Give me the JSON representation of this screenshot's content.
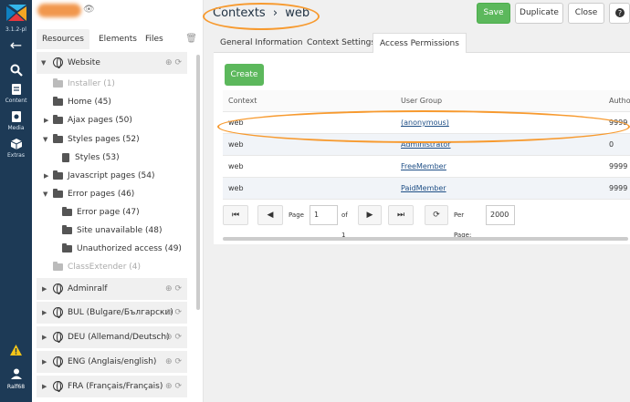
{
  "rail": {
    "version": "3.1.2-pl",
    "nav": [
      {
        "icon": "search-icon",
        "label": ""
      },
      {
        "icon": "content-icon",
        "label": "Content"
      },
      {
        "icon": "media-icon",
        "label": "Media"
      },
      {
        "icon": "extras-icon",
        "label": "Extras"
      }
    ],
    "user": "Ralf68"
  },
  "tree": {
    "tabs": [
      "Resources",
      "Elements",
      "Files"
    ],
    "nodes": [
      {
        "label": "Website",
        "type": "context"
      },
      {
        "label": "Installer (1)",
        "type": "folder",
        "dim": true
      },
      {
        "label": "Home (45)",
        "type": "folder"
      },
      {
        "label": "Ajax pages (50)",
        "type": "folder"
      },
      {
        "label": "Styles pages (52)",
        "type": "folder"
      },
      {
        "label": "Styles (53)",
        "type": "page"
      },
      {
        "label": "Javascript pages (54)",
        "type": "folder"
      },
      {
        "label": "Error pages (46)",
        "type": "folder"
      },
      {
        "label": "Error page (47)",
        "type": "folder"
      },
      {
        "label": "Site unavailable (48)",
        "type": "folder"
      },
      {
        "label": "Unauthorized access (49)",
        "type": "folder"
      },
      {
        "label": "ClassExtender (4)",
        "type": "folder",
        "dim": true
      }
    ],
    "contexts": [
      "Adminralf",
      "BUL (Bulgare/Български)",
      "DEU (Allemand/Deutsch)",
      "ENG (Anglais/english)",
      "FRA (Français/Français)"
    ]
  },
  "main": {
    "breadcrumb": {
      "root": "Contexts",
      "sep": "›",
      "current": "web"
    },
    "buttons": {
      "save": "Save",
      "duplicate": "Duplicate",
      "close": "Close"
    },
    "tabs": [
      "General Information",
      "Context Settings",
      "Access Permissions"
    ],
    "create_label": "Create",
    "grid": {
      "headers": [
        "Context",
        "User Group",
        "Autho"
      ],
      "rows": [
        {
          "context": "web",
          "group": "(anonymous)",
          "auth": "9999"
        },
        {
          "context": "web",
          "group": "Administrator",
          "auth": "0"
        },
        {
          "context": "web",
          "group": "FreeMember",
          "auth": "9999"
        },
        {
          "context": "web",
          "group": "PaidMember",
          "auth": "9999"
        }
      ]
    },
    "pager": {
      "page_label": "Page",
      "page_value": "1",
      "of_label": "of 1",
      "per_page_label": "Per Page:",
      "per_page_value": "2000"
    }
  },
  "colors": {
    "rail": "#1d3a56",
    "accent": "#5cb85c",
    "annotation": "#f79a2f"
  }
}
